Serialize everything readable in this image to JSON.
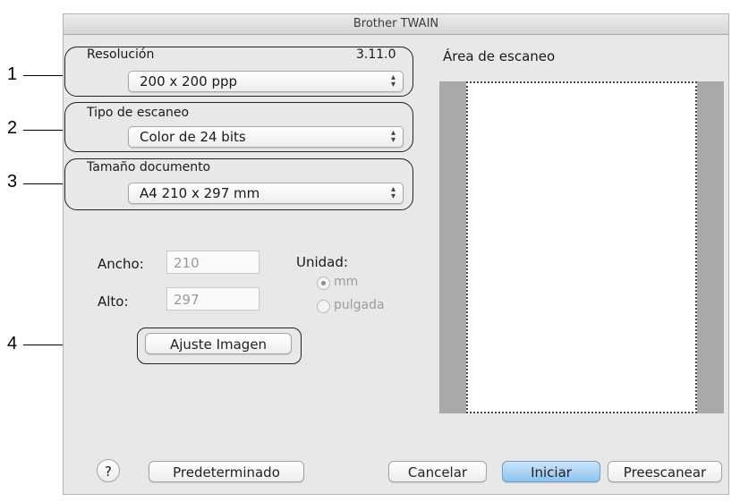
{
  "window": {
    "title": "Brother TWAIN"
  },
  "callouts": [
    "1",
    "2",
    "3",
    "4"
  ],
  "resolution": {
    "label": "Resolución",
    "value": "200 x 200 ppp",
    "version": "3.11.0"
  },
  "scan_type": {
    "label": "Tipo de escaneo",
    "value": "Color de 24 bits"
  },
  "doc_size": {
    "label": "Tamaño documento",
    "value": "A4  210 x 297 mm"
  },
  "dimensions": {
    "width_label": "Ancho:",
    "width_value": "210",
    "height_label": "Alto:",
    "height_value": "297"
  },
  "unit": {
    "label": "Unidad:",
    "options": [
      "mm",
      "pulgada"
    ],
    "selected": "mm"
  },
  "adjust_button": "Ajuste Imagen",
  "scan_area": {
    "label": "Área de escaneo"
  },
  "footer": {
    "help": "?",
    "default_button": "Predeterminado",
    "cancel_button": "Cancelar",
    "start_button": "Iniciar",
    "prescan_button": "Preescanear"
  },
  "colors": {
    "accent": "#8cc2f1",
    "window_bg": "#e8e8e8",
    "scan_margin": "#a9a9a9"
  },
  "icons": {
    "select_arrows": "up-down-chevron-icon",
    "help": "question-mark-icon"
  }
}
